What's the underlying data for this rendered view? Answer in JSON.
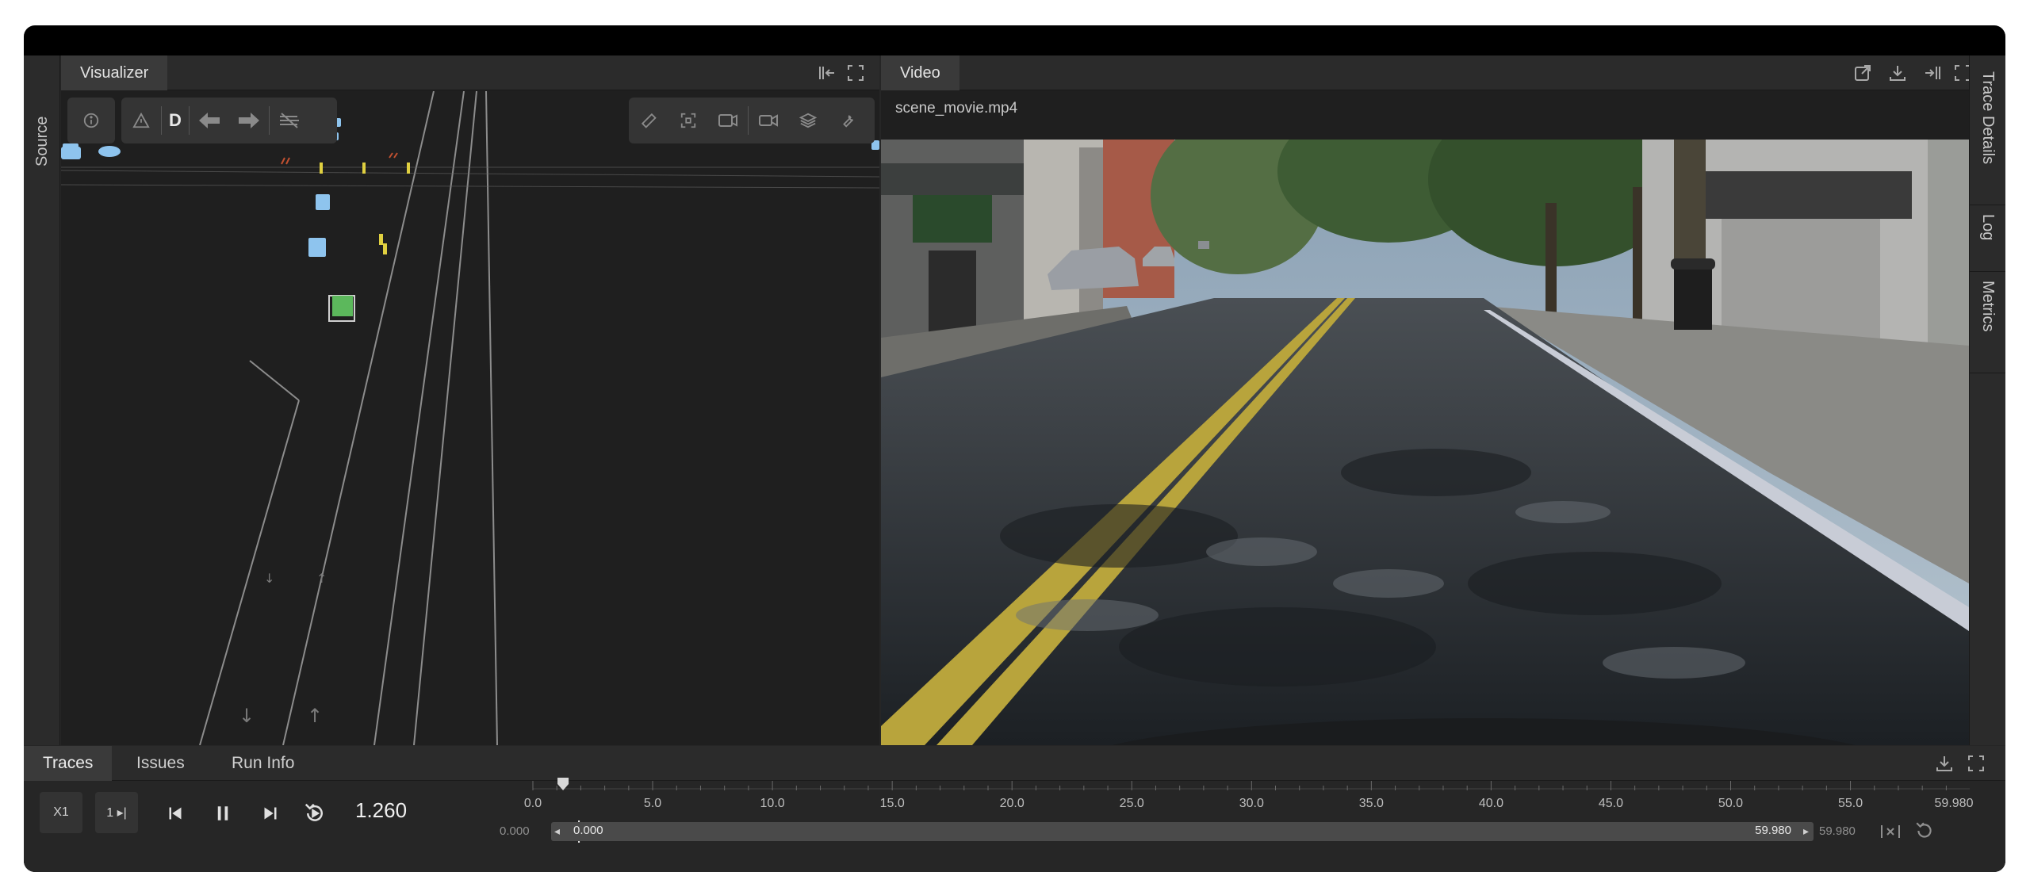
{
  "left_rail": {
    "label": "Source"
  },
  "visualizer": {
    "tab_label": "Visualizer",
    "tools_left": [
      "info-icon",
      "warning-icon",
      "D",
      "arrow-left-icon",
      "arrow-right-icon",
      "stripes-icon"
    ],
    "tools_right": [
      "ruler-icon",
      "focus-icon",
      "camera-follow-icon",
      "video-camera-icon",
      "layers-icon",
      "wrench-icon"
    ],
    "drive_mode_label": "D"
  },
  "video": {
    "tab_label": "Video",
    "file_name": "scene_movie.mp4"
  },
  "right_rail": {
    "tabs": [
      "Trace Details",
      "Log",
      "Metrics"
    ]
  },
  "bottom": {
    "tabs": [
      "Traces",
      "Issues",
      "Run Info"
    ],
    "speed_label": "X1",
    "step_label": "1 ▸|",
    "current_time": "1.260",
    "ruler_labels": [
      "0.0",
      "5.0",
      "10.0",
      "15.0",
      "20.0",
      "25.0",
      "30.0",
      "35.0",
      "40.0",
      "45.0",
      "50.0",
      "55.0",
      "59.980"
    ],
    "range_start_outer": "0.000",
    "range_start": "0.000",
    "range_end": "59.980",
    "range_end_outer": "59.980",
    "playhead_time": 1.26,
    "duration": 59.98
  },
  "colors": {
    "ego_vehicle": "#5cb85c",
    "agent_vehicle": "#8ec4ee",
    "lane_marker": "#e0d040",
    "panel_bg": "#1f1f1f"
  }
}
